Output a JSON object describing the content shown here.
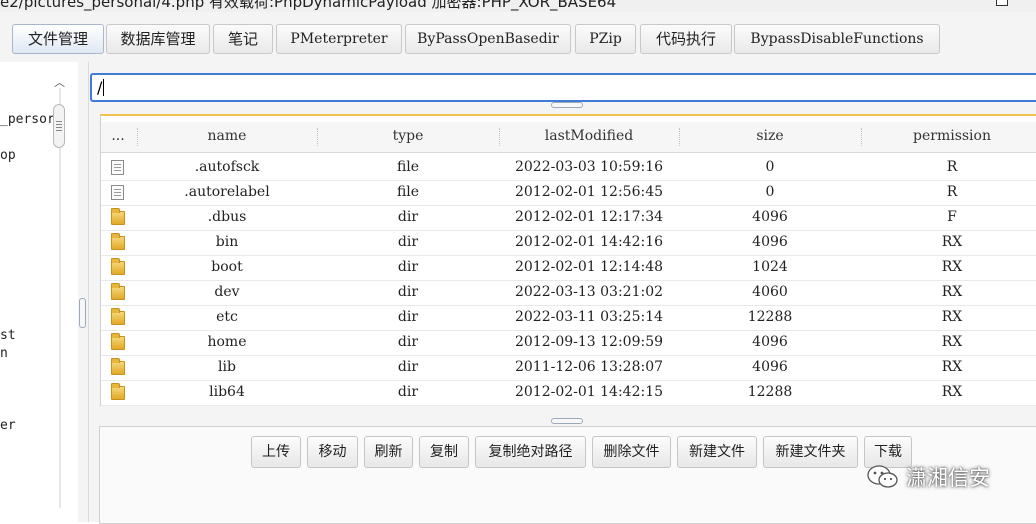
{
  "window": {
    "title": "e2/pictures_personal/4.php 有效载荷:PhpDynamicPayload 加密器:PHP_XOR_BASE64"
  },
  "tabs": [
    {
      "label": "文件管理",
      "active": true
    },
    {
      "label": "数据库管理",
      "active": false
    },
    {
      "label": "笔记",
      "active": false
    },
    {
      "label": "PMeterpreter",
      "active": false
    },
    {
      "label": "ByPassOpenBasedir",
      "active": false
    },
    {
      "label": "PZip",
      "active": false
    },
    {
      "label": "代码执行",
      "active": false
    },
    {
      "label": "BypassDisableFunctions",
      "active": false
    }
  ],
  "tree": {
    "items": [
      "_persor",
      "op",
      "st",
      "n",
      "er"
    ]
  },
  "path": {
    "value": "/"
  },
  "file_table": {
    "headers": [
      "...",
      "name",
      "type",
      "lastModified",
      "size",
      "permission"
    ],
    "rows": [
      {
        "icon": "file",
        "name": ".autofsck",
        "type": "file",
        "lastModified": "2022-03-03 10:59:16",
        "size": "0",
        "permission": "R"
      },
      {
        "icon": "file",
        "name": ".autorelabel",
        "type": "file",
        "lastModified": "2012-02-01 12:56:45",
        "size": "0",
        "permission": "R"
      },
      {
        "icon": "dir",
        "name": ".dbus",
        "type": "dir",
        "lastModified": "2012-02-01 12:17:34",
        "size": "4096",
        "permission": "F"
      },
      {
        "icon": "dir",
        "name": "bin",
        "type": "dir",
        "lastModified": "2012-02-01 14:42:16",
        "size": "4096",
        "permission": "RX"
      },
      {
        "icon": "dir",
        "name": "boot",
        "type": "dir",
        "lastModified": "2012-02-01 12:14:48",
        "size": "1024",
        "permission": "RX"
      },
      {
        "icon": "dir",
        "name": "dev",
        "type": "dir",
        "lastModified": "2022-03-13 03:21:02",
        "size": "4060",
        "permission": "RX"
      },
      {
        "icon": "dir",
        "name": "etc",
        "type": "dir",
        "lastModified": "2022-03-11 03:25:14",
        "size": "12288",
        "permission": "RX"
      },
      {
        "icon": "dir",
        "name": "home",
        "type": "dir",
        "lastModified": "2012-09-13 12:09:59",
        "size": "4096",
        "permission": "RX"
      },
      {
        "icon": "dir",
        "name": "lib",
        "type": "dir",
        "lastModified": "2011-12-06 13:28:07",
        "size": "4096",
        "permission": "RX"
      },
      {
        "icon": "dir",
        "name": "lib64",
        "type": "dir",
        "lastModified": "2012-02-01 14:42:15",
        "size": "12288",
        "permission": "RX"
      }
    ]
  },
  "actions": {
    "upload": "上传",
    "move": "移动",
    "refresh": "刷新",
    "copy": "复制",
    "copy_abs_path": "复制绝对路径",
    "delete_file": "删除文件",
    "new_file": "新建文件",
    "new_folder": "新建文件夹",
    "download": "下载"
  },
  "watermark": {
    "text": "潇湘信安",
    "icon": "wechat-icon"
  },
  "colors": {
    "accent_border": "#3f7ad6",
    "header_top": "#f2c24a",
    "folder": "#e9b63c"
  }
}
